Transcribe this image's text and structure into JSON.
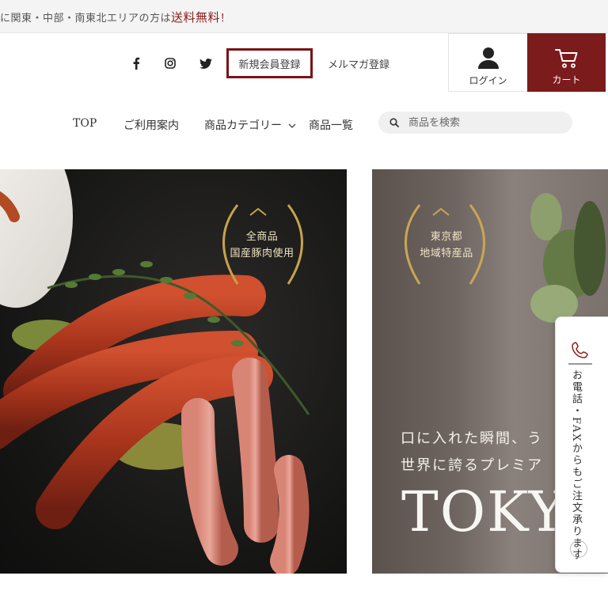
{
  "announcement": {
    "prefix": "に関東・中部・南東北エリアの方は",
    "highlight": "送料無料",
    "suffix": "！"
  },
  "header": {
    "social": [
      "facebook-icon",
      "instagram-icon",
      "twitter-icon"
    ],
    "register_label": "新規会員登録",
    "newsletter_label": "メルマガ登録",
    "login_label": "ログイン",
    "cart_label": "カート",
    "accent_color": "#7b1b1b"
  },
  "nav": {
    "items": [
      {
        "label": "TOP"
      },
      {
        "label": "ご利用案内"
      },
      {
        "label": "商品カテゴリー"
      },
      {
        "label": "商品一覧"
      }
    ],
    "search_placeholder": "商品を検索"
  },
  "hero": {
    "slide1_badge_line1": "全商品",
    "slide1_badge_line2": "国産豚肉使用",
    "slide2_badge_line1": "東京都",
    "slide2_badge_line2": "地域特産品",
    "headline_line1": "口に入れた瞬間、う",
    "headline_line2": "世界に誇るプレミア",
    "big_word": "TOKYO"
  },
  "side_tab": {
    "text": "お電話・FAXからもご注文承ります"
  }
}
